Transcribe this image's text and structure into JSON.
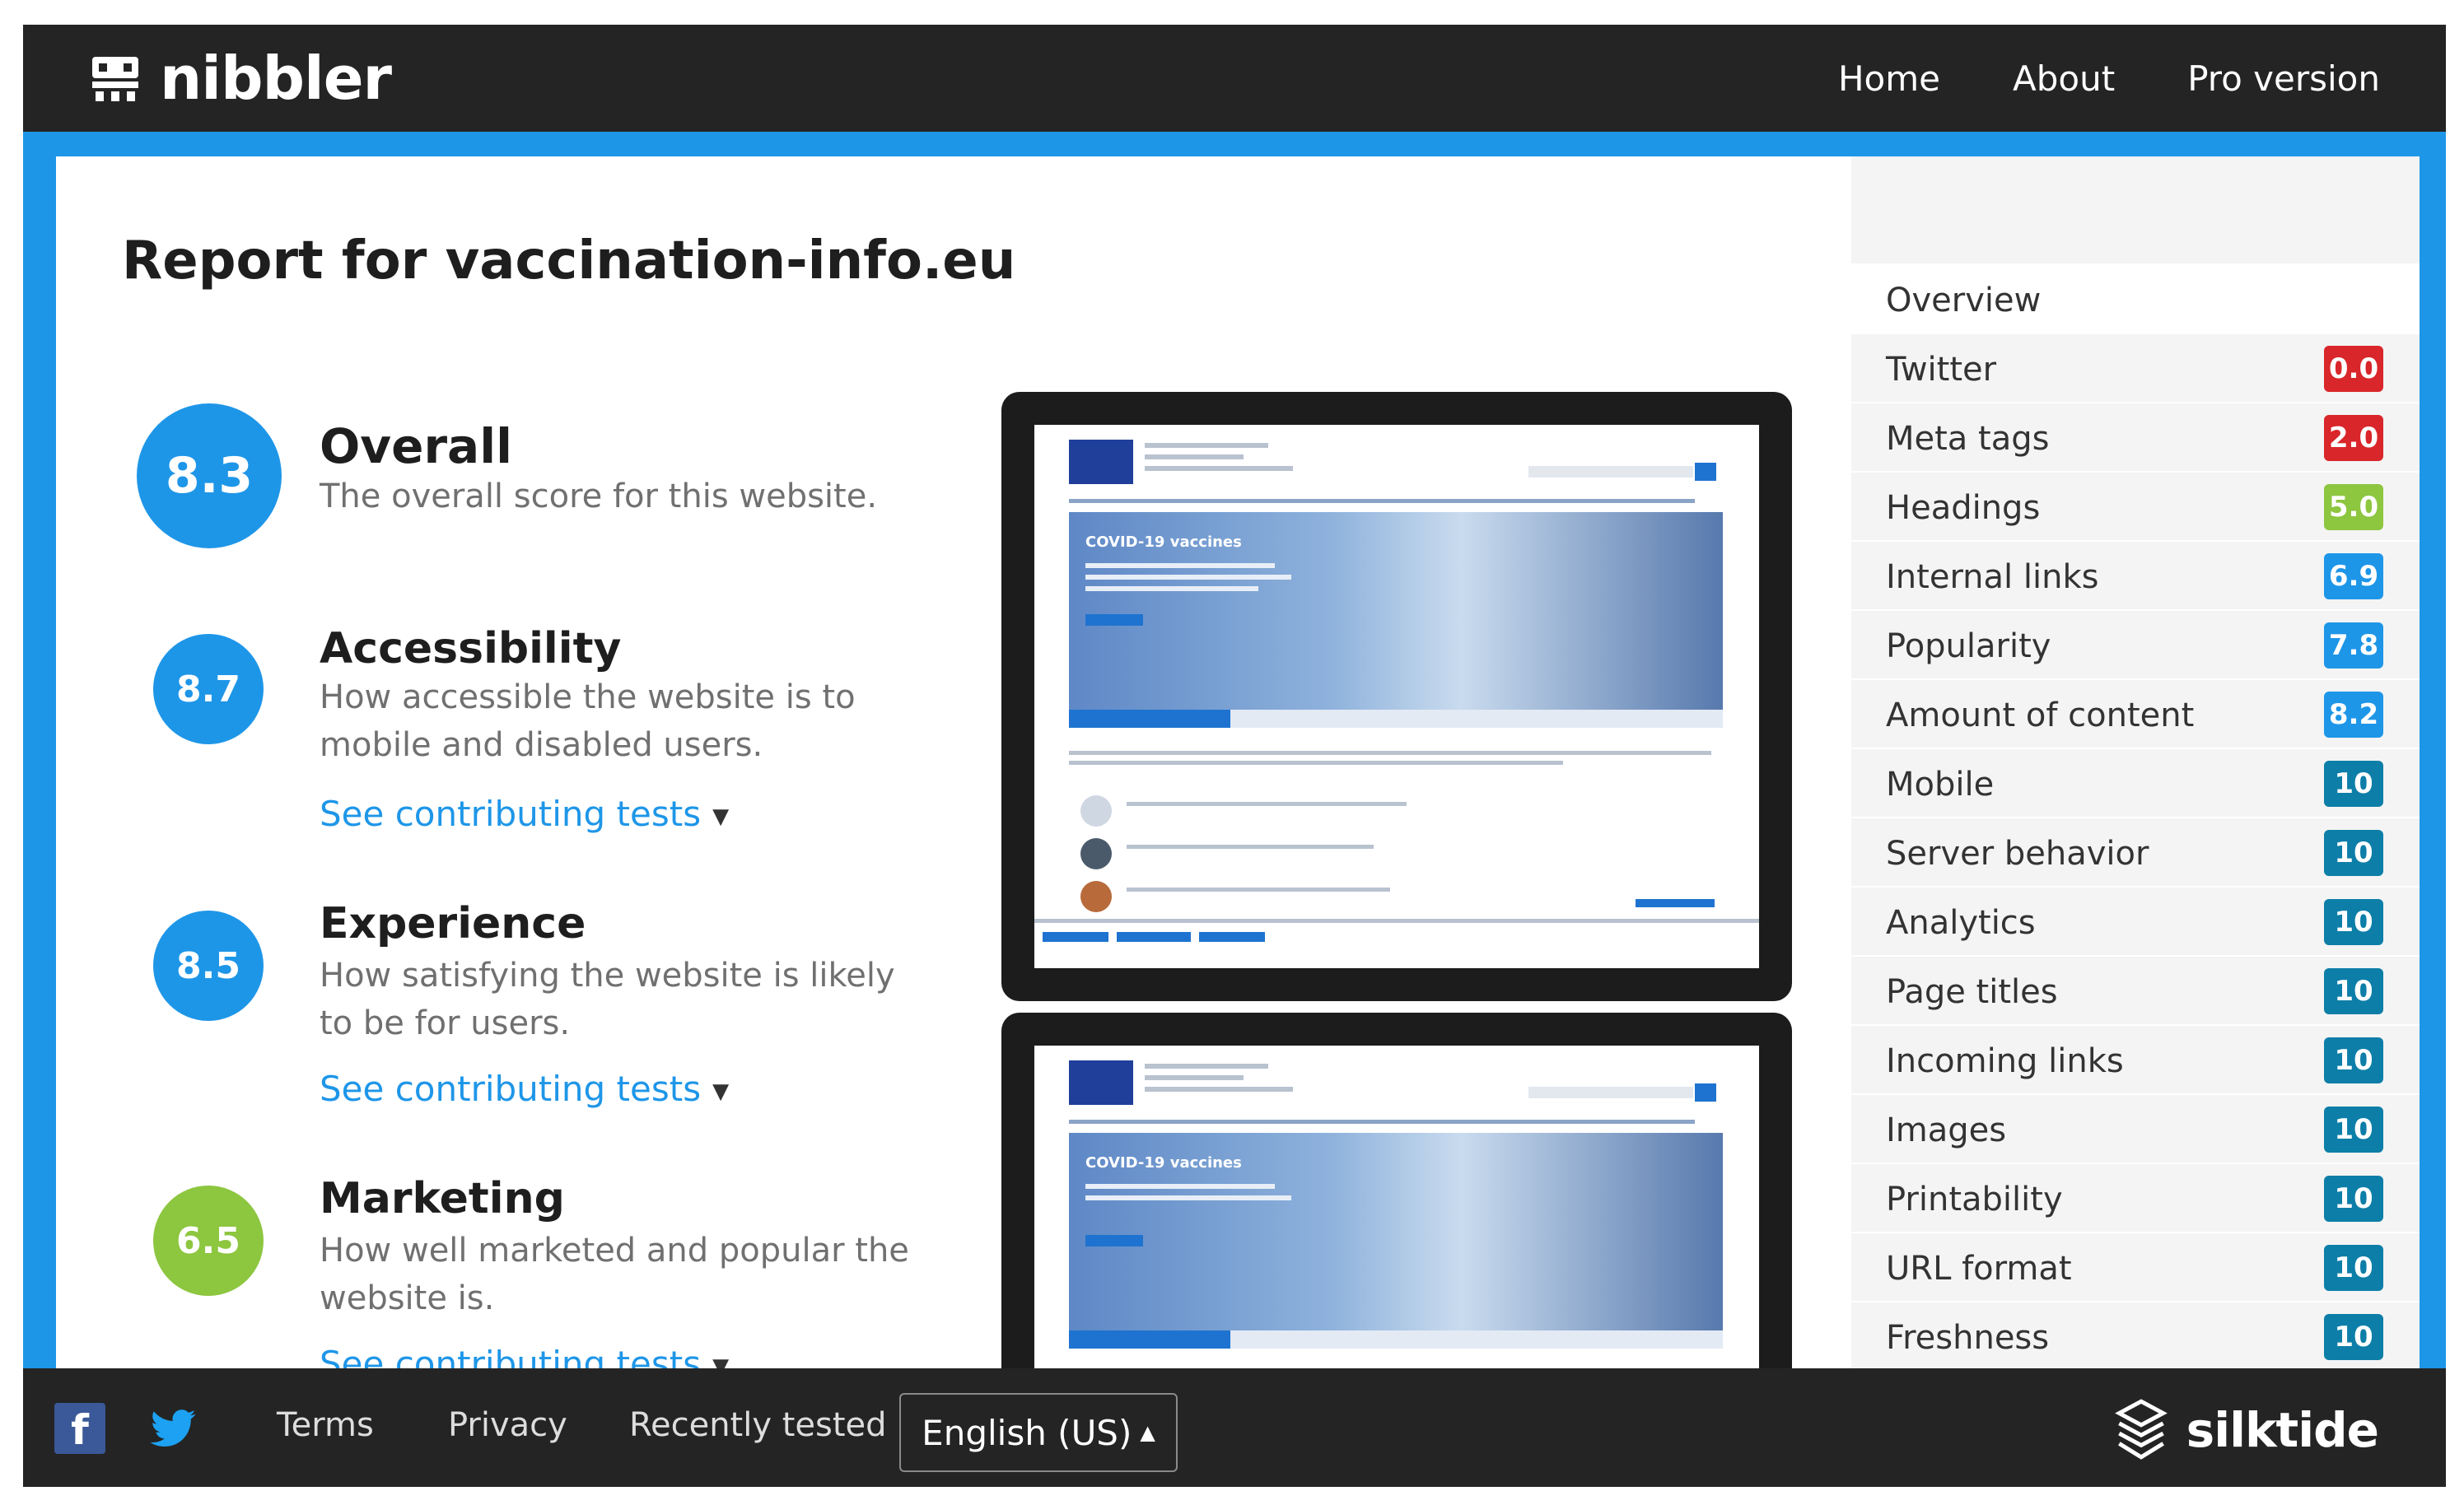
{
  "app": {
    "logo_text": "nibbler"
  },
  "nav": {
    "items": [
      {
        "label": "Home"
      },
      {
        "label": "About"
      },
      {
        "label": "Pro version"
      }
    ]
  },
  "report": {
    "title": "Report for vaccination-info.eu"
  },
  "scores": [
    {
      "score": "8.3",
      "title": "Overall",
      "desc": "The overall score for this website.",
      "link": "",
      "color": "#1e96e8"
    },
    {
      "score": "8.7",
      "title": "Accessibility",
      "desc": "How accessible the website is to mobile and disabled users.",
      "link": "See contributing tests",
      "color": "#1e96e8"
    },
    {
      "score": "8.5",
      "title": "Experience",
      "desc": "How satisfying the website is likely to be for users.",
      "link": "See contributing tests",
      "color": "#1e96e8"
    },
    {
      "score": "6.5",
      "title": "Marketing",
      "desc": "How well marketed and popular the website is.",
      "link": "See contributing tests",
      "color": "#8dc63f"
    }
  ],
  "preview": {
    "hero_title": "COVID-19 vaccines"
  },
  "sidebar": {
    "overview_label": "Overview",
    "items": [
      {
        "label": "Twitter",
        "score": "0.0",
        "color": "#d9262a"
      },
      {
        "label": "Meta tags",
        "score": "2.0",
        "color": "#d9262a"
      },
      {
        "label": "Headings",
        "score": "5.0",
        "color": "#8dc63f"
      },
      {
        "label": "Internal links",
        "score": "6.9",
        "color": "#1e96e8"
      },
      {
        "label": "Popularity",
        "score": "7.8",
        "color": "#1e96e8"
      },
      {
        "label": "Amount of content",
        "score": "8.2",
        "color": "#1e96e8"
      },
      {
        "label": "Mobile",
        "score": "10",
        "color": "#0d7ea8"
      },
      {
        "label": "Server behavior",
        "score": "10",
        "color": "#0d7ea8"
      },
      {
        "label": "Analytics",
        "score": "10",
        "color": "#0d7ea8"
      },
      {
        "label": "Page titles",
        "score": "10",
        "color": "#0d7ea8"
      },
      {
        "label": "Incoming links",
        "score": "10",
        "color": "#0d7ea8"
      },
      {
        "label": "Images",
        "score": "10",
        "color": "#0d7ea8"
      },
      {
        "label": "Printability",
        "score": "10",
        "color": "#0d7ea8"
      },
      {
        "label": "URL format",
        "score": "10",
        "color": "#0d7ea8"
      },
      {
        "label": "Freshness",
        "score": "10",
        "color": "#0d7ea8"
      }
    ]
  },
  "footer": {
    "links": [
      {
        "label": "Terms"
      },
      {
        "label": "Privacy"
      },
      {
        "label": "Recently tested"
      }
    ],
    "language": "English (US)",
    "brand": "silktide"
  },
  "colors": {
    "topbar": "#242424",
    "accent_blue": "#1e96e8",
    "green": "#8dc63f",
    "red": "#d9262a",
    "teal": "#0d7ea8"
  }
}
